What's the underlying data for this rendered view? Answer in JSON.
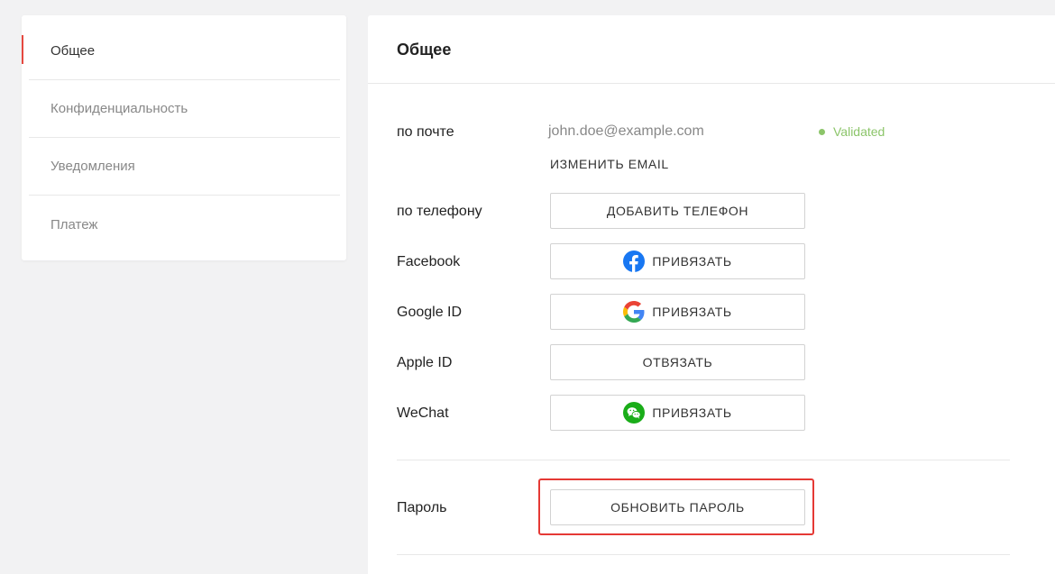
{
  "sidebar": {
    "items": [
      {
        "label": "Общее",
        "active": true
      },
      {
        "label": "Конфиденциальность",
        "active": false
      },
      {
        "label": "Уведомления",
        "active": false
      },
      {
        "label": "Платеж",
        "active": false
      }
    ],
    "active_color": "#e5483f"
  },
  "main": {
    "title": "Общее",
    "email": {
      "label": "по почте",
      "value": "john.doe@example.com",
      "status": "Validated",
      "status_color": "#8cc56a",
      "change_label": "ИЗМЕНИТЬ EMAIL"
    },
    "phone": {
      "label": "по телефону",
      "button_label": "ДОБАВИТЬ ТЕЛЕФОН"
    },
    "facebook": {
      "label": "Facebook",
      "button_label": "ПРИВЯЗАТЬ",
      "icon": "facebook-icon"
    },
    "google": {
      "label": "Google ID",
      "button_label": "ПРИВЯЗАТЬ",
      "icon": "google-icon"
    },
    "apple": {
      "label": "Apple ID",
      "button_label": "ОТВЯЗАТЬ"
    },
    "wechat": {
      "label": "WeChat",
      "button_label": "ПРИВЯЗАТЬ",
      "icon": "wechat-icon"
    },
    "password": {
      "label": "Пароль",
      "button_label": "ОБНОВИТЬ ПАРОЛЬ",
      "highlight_color": "#e53935"
    }
  }
}
